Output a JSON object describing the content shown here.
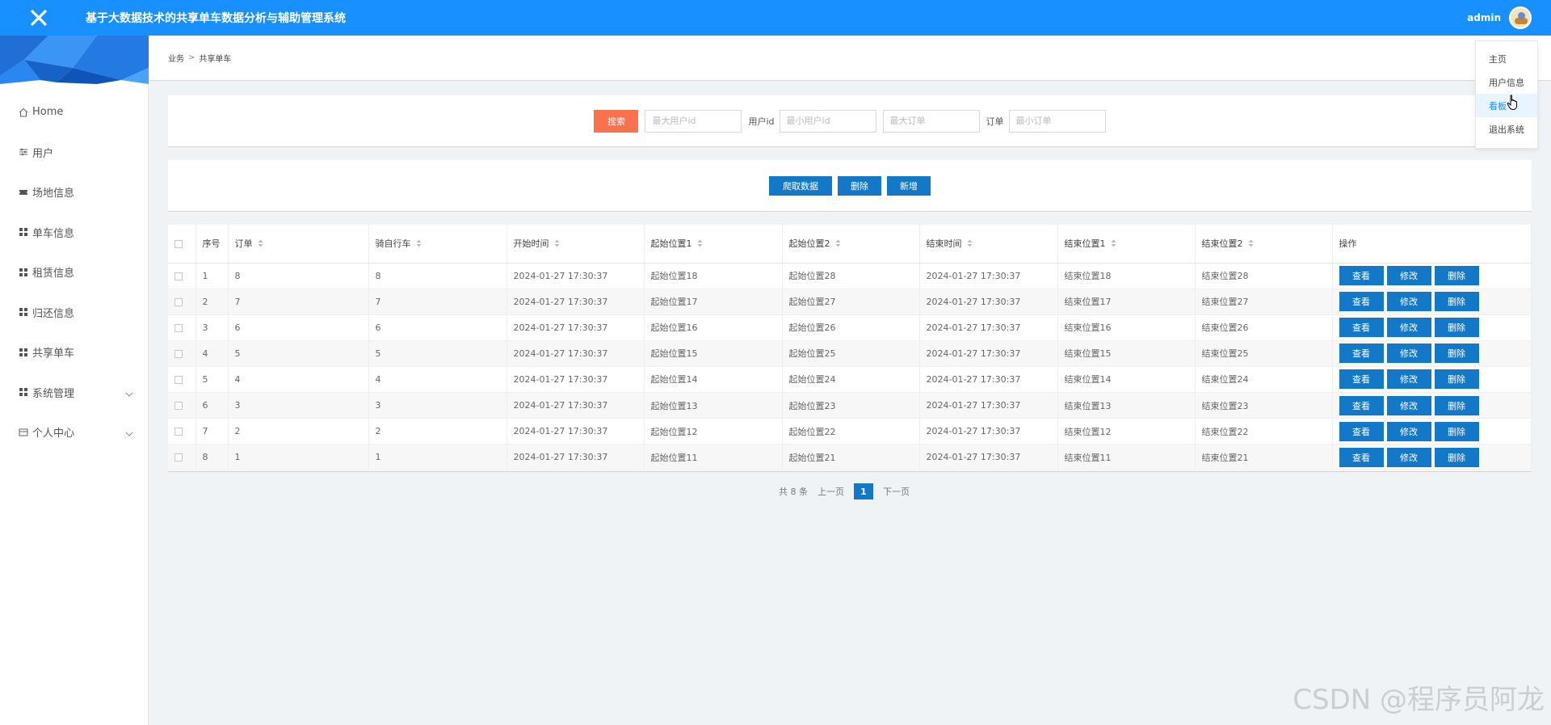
{
  "header": {
    "title": "基于大数据技术的共享单车数据分析与辅助管理系统",
    "username": "admin"
  },
  "sidebar": {
    "items": [
      {
        "label": "Home",
        "icon": "home-icon"
      },
      {
        "label": "用户",
        "icon": "sliders-icon"
      },
      {
        "label": "场地信息",
        "icon": "ticket-icon"
      },
      {
        "label": "单车信息",
        "icon": "grid-icon"
      },
      {
        "label": "租赁信息",
        "icon": "grid-icon"
      },
      {
        "label": "归还信息",
        "icon": "grid-icon"
      },
      {
        "label": "共享单车",
        "icon": "grid-icon"
      },
      {
        "label": "系统管理",
        "icon": "grid-icon",
        "expandable": true
      },
      {
        "label": "个人中心",
        "icon": "card-icon",
        "expandable": true
      }
    ]
  },
  "breadcrumb": {
    "parent": "业务",
    "separator": ">",
    "current": "共享单车"
  },
  "search": {
    "button": "搜索",
    "max_user_placeholder": "最大用户id",
    "user_label": "用户id",
    "min_user_placeholder": "最小用户id",
    "max_order_placeholder": "最大订单",
    "order_label": "订单",
    "min_order_placeholder": "最小订单"
  },
  "actions": {
    "crawl": "爬取数据",
    "delete": "删除",
    "add": "新增"
  },
  "table": {
    "headers": [
      "序号",
      "订单",
      "骑自行车",
      "开始时间",
      "起始位置1",
      "起始位置2",
      "结束时间",
      "结束位置1",
      "结束位置2",
      "操作"
    ],
    "rows": [
      [
        "1",
        "8",
        "8",
        "2024-01-27 17:30:37",
        "起始位置18",
        "起始位置28",
        "2024-01-27 17:30:37",
        "结束位置18",
        "结束位置28"
      ],
      [
        "2",
        "7",
        "7",
        "2024-01-27 17:30:37",
        "起始位置17",
        "起始位置27",
        "2024-01-27 17:30:37",
        "结束位置17",
        "结束位置27"
      ],
      [
        "3",
        "6",
        "6",
        "2024-01-27 17:30:37",
        "起始位置16",
        "起始位置26",
        "2024-01-27 17:30:37",
        "结束位置16",
        "结束位置26"
      ],
      [
        "4",
        "5",
        "5",
        "2024-01-27 17:30:37",
        "起始位置15",
        "起始位置25",
        "2024-01-27 17:30:37",
        "结束位置15",
        "结束位置25"
      ],
      [
        "5",
        "4",
        "4",
        "2024-01-27 17:30:37",
        "起始位置14",
        "起始位置24",
        "2024-01-27 17:30:37",
        "结束位置14",
        "结束位置24"
      ],
      [
        "6",
        "3",
        "3",
        "2024-01-27 17:30:37",
        "起始位置13",
        "起始位置23",
        "2024-01-27 17:30:37",
        "结束位置13",
        "结束位置23"
      ],
      [
        "7",
        "2",
        "2",
        "2024-01-27 17:30:37",
        "起始位置12",
        "起始位置22",
        "2024-01-27 17:30:37",
        "结束位置12",
        "结束位置22"
      ],
      [
        "8",
        "1",
        "1",
        "2024-01-27 17:30:37",
        "起始位置11",
        "起始位置21",
        "2024-01-27 17:30:37",
        "结束位置11",
        "结束位置21"
      ]
    ],
    "row_actions": {
      "view": "查看",
      "edit": "修改",
      "delete": "删除"
    }
  },
  "pagination": {
    "total": "共 8 条",
    "prev": "上一页",
    "current": "1",
    "next": "下一页"
  },
  "dropdown": {
    "items": [
      "主页",
      "用户信息",
      "看板",
      "退出系统"
    ]
  },
  "watermark": "CSDN @程序员阿龙",
  "colors": {
    "primary": "#1890ff",
    "button": "#1478c8",
    "search_button": "#f8724e"
  }
}
